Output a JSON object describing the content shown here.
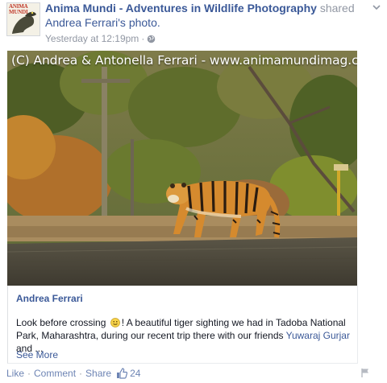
{
  "post": {
    "page_name": "Anima Mundi - Adventures in Wildlife Photography",
    "verb": "shared",
    "shared_from": "Andrea Ferrari's photo.",
    "timestamp": "Yesterday at 12:19pm",
    "audience_icon": "globe-icon",
    "avatar_text": "ANIMA MUNDI"
  },
  "photo": {
    "watermark": "(C) Andrea & Antonella Ferrari - www.animamundimag.com",
    "subject": "tiger"
  },
  "shared": {
    "author": "Andrea Ferrari",
    "caption_part1": "Look before crossing",
    "caption_part2": "! A beautiful tiger sighting we had in Tadoba National Park, Maharashtra, during our recent trip there with our friends ",
    "mention": "Yuwaraj Gurjar",
    "caption_part3": " and ...",
    "see_more": "See More"
  },
  "actions": {
    "like": "Like",
    "comment": "Comment",
    "share": "Share",
    "like_count": "24"
  },
  "colors": {
    "link": "#3b5998",
    "muted": "#9197a3",
    "action": "#6d84b4"
  }
}
